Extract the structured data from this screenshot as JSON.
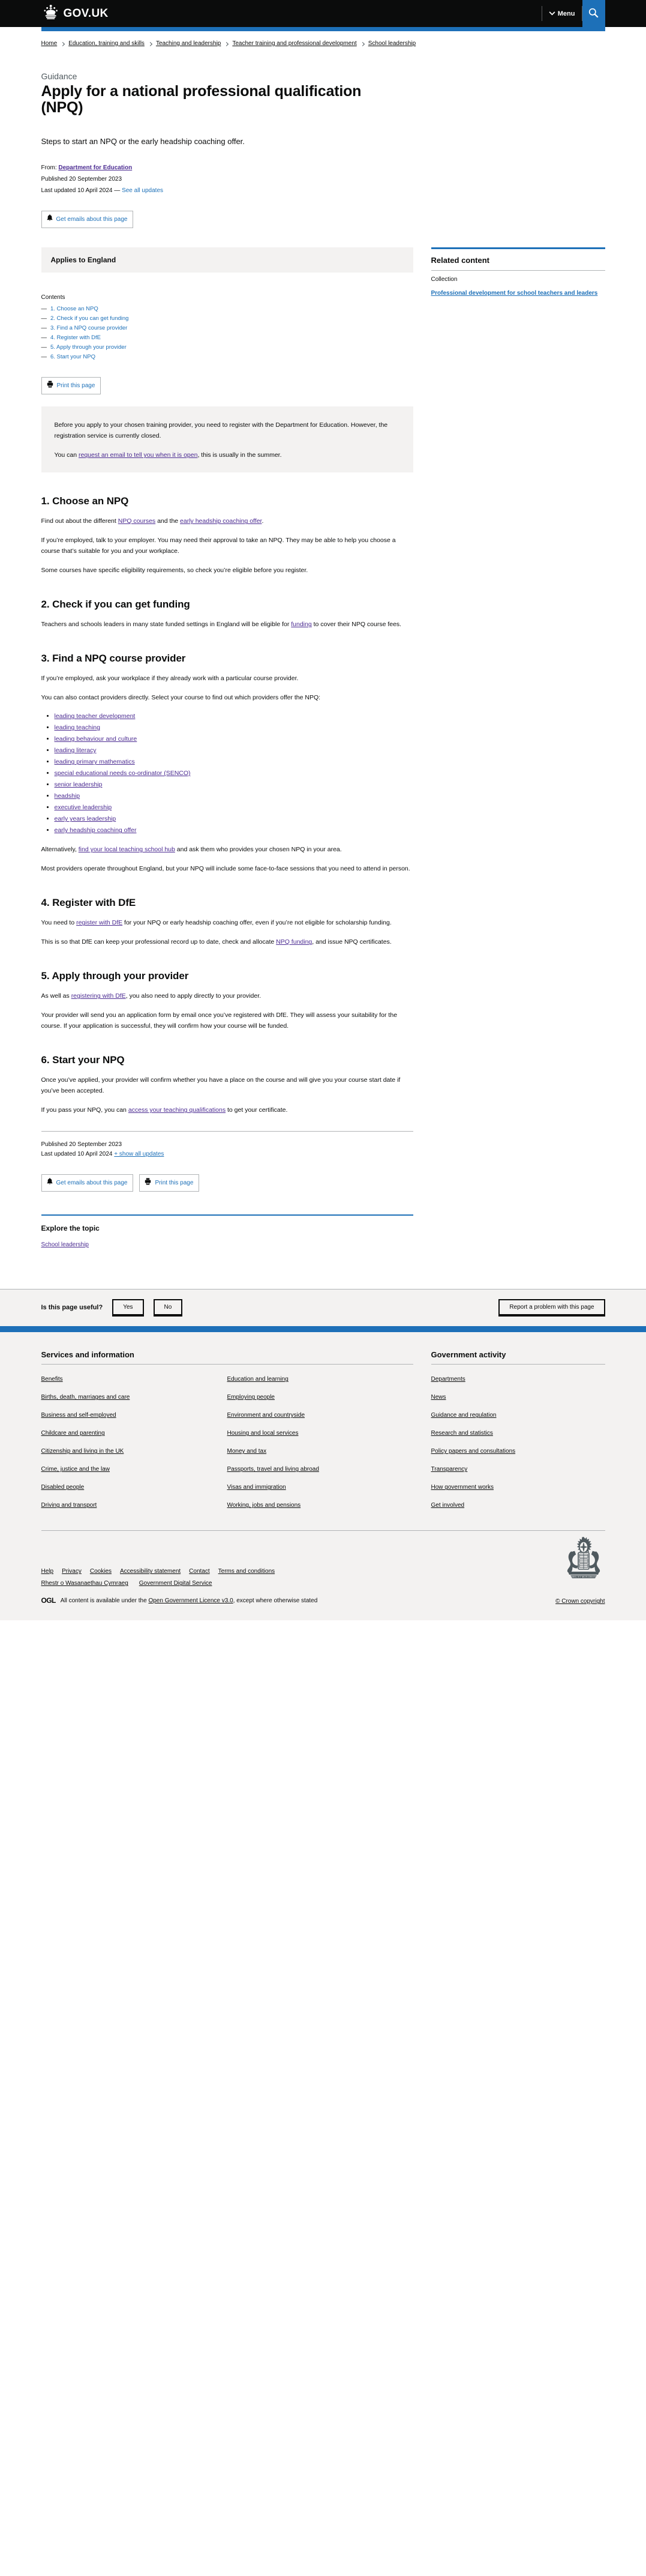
{
  "header": {
    "brand": "GOV.UK",
    "menu_label": "Menu",
    "search_label": "Search"
  },
  "breadcrumbs": [
    "Home",
    "Education, training and skills",
    "Teaching and leadership",
    "Teacher training and professional development",
    "School leadership"
  ],
  "title_block": {
    "context": "Guidance",
    "title": "Apply for a national professional qualification (NPQ)",
    "lede": "Steps to start an NPQ or the early headship coaching offer."
  },
  "metadata": {
    "from_label": "From:",
    "from_org": "Department for Education",
    "published_label": "Published",
    "published_date": "20 September 2023",
    "updated_label": "Last updated",
    "updated_date": "10 April 2024",
    "updated_sep": "—",
    "see_all_updates": "See all updates"
  },
  "actions": {
    "get_emails": "Get emails about this page",
    "print": "Print this page",
    "show_all_updates": "+ show all updates"
  },
  "applies_to": "Applies to England",
  "contents": {
    "label": "Contents",
    "items": [
      "1. Choose an NPQ",
      "2. Check if you can get funding",
      "3. Find a NPQ course provider",
      "4. Register with DfE",
      "5. Apply through your provider",
      "6. Start your NPQ"
    ]
  },
  "related": {
    "heading": "Related content",
    "kind": "Collection",
    "link": "Professional development for school teachers and leaders"
  },
  "callout": {
    "p1": "Before you apply to your chosen training provider, you need to register with the Department for Education. However, the registration service is currently closed.",
    "p2_pre": "You can ",
    "p2_link": "request an email to tell you when it is open",
    "p2_post": ", this is usually in the summer."
  },
  "sections": {
    "s1": {
      "heading": "1. Choose an NPQ",
      "p1_pre": "Find out about the different ",
      "p1_link1": "NPQ courses",
      "p1_mid": " and the ",
      "p1_link2": "early headship coaching offer",
      "p1_post": ".",
      "p2": "If you’re employed, talk to your employer. You may need their approval to take an NPQ. They may be able to help you choose a course that’s suitable for you and your workplace.",
      "p3": "Some courses have specific eligibility requirements, so check you’re eligible before you register."
    },
    "s2": {
      "heading": "2. Check if you can get funding",
      "p1_pre": "Teachers and schools leaders in many state funded settings in England will be eligible for ",
      "p1_link": "funding",
      "p1_post": " to cover their NPQ course fees."
    },
    "s3": {
      "heading": "3. Find a NPQ course provider",
      "p1": "If you’re employed, ask your workplace if they already work with a particular course provider.",
      "p2": "You can also contact providers directly. Select your course to find out which providers offer the NPQ:",
      "courses": [
        "leading teacher development",
        "leading teaching",
        "leading behaviour and culture",
        "leading literacy",
        "leading primary mathematics",
        "special educational needs co-ordinator (SENCO)",
        "senior leadership",
        "headship",
        "executive leadership",
        "early years leadership",
        "early headship coaching offer"
      ],
      "p3_pre": "Alternatively, ",
      "p3_link": "find your local teaching school hub",
      "p3_post": " and ask them who provides your chosen NPQ in your area.",
      "p4": "Most providers operate throughout England, but your NPQ will include some face-to-face sessions that you need to attend in person."
    },
    "s4": {
      "heading": "4. Register with DfE",
      "p1_pre": "You need to ",
      "p1_link": "register with DfE",
      "p1_post": " for your NPQ or early headship coaching offer, even if you’re not eligible for scholarship funding.",
      "p2_pre": "This is so that DfE can keep your professional record up to date, check and allocate ",
      "p2_link": "NPQ funding",
      "p2_post": ", and issue NPQ certificates."
    },
    "s5": {
      "heading": "5. Apply through your provider",
      "p1_pre": "As well as ",
      "p1_link": "registering with DfE",
      "p1_post": ", you also need to apply directly to your provider.",
      "p2": "Your provider will send you an application form by email once you’ve registered with DfE. They will assess your suitability for the course. If your application is successful, they will confirm how your course will be funded."
    },
    "s6": {
      "heading": "6. Start your NPQ",
      "p1": "Once you’ve applied, your provider will confirm whether you have a place on the course and will give you your course start date if you’ve been accepted.",
      "p2_pre": "If you pass your NPQ, you can ",
      "p2_link": "access your teaching qualifications",
      "p2_post": " to get your certificate."
    }
  },
  "explore": {
    "heading": "Explore the topic",
    "link": "School leadership"
  },
  "feedback": {
    "question": "Is this page useful?",
    "yes": "Yes",
    "no": "No",
    "report": "Report a problem with this page"
  },
  "footer": {
    "services_heading": "Services and information",
    "services_col1": [
      "Benefits",
      "Births, death, marriages and care",
      "Business and self-employed",
      "Childcare and parenting",
      "Citizenship and living in the UK",
      "Crime, justice and the law",
      "Disabled people",
      "Driving and transport"
    ],
    "services_col2": [
      "Education and learning",
      "Employing people",
      "Environment and countryside",
      "Housing and local services",
      "Money and tax",
      "Passports, travel and living abroad",
      "Visas and immigration",
      "Working, jobs and pensions"
    ],
    "government_heading": "Government activity",
    "government_links": [
      "Departments",
      "News",
      "Guidance and regulation",
      "Research and statistics",
      "Policy papers and consultations",
      "Transparency",
      "How government works",
      "Get involved"
    ],
    "meta_links_1": [
      "Help",
      "Privacy",
      "Cookies",
      "Accessibility statement",
      "Contact",
      "Terms and conditions"
    ],
    "meta_links_2": [
      "Rhestr o Wasanaethau Cymraeg",
      "Government Digital Service"
    ],
    "ogl_logo": "OGL",
    "ogl_pre": "All content is available under the ",
    "ogl_link": "Open Government Licence v3.0",
    "ogl_post": ", except where otherwise stated",
    "crown_copyright": "© Crown copyright"
  },
  "colors": {
    "brand_black": "#0b0c0c",
    "accent_blue": "#1d70b8",
    "link_visited": "#4c2c92",
    "grey_panel": "#f3f2f1"
  }
}
